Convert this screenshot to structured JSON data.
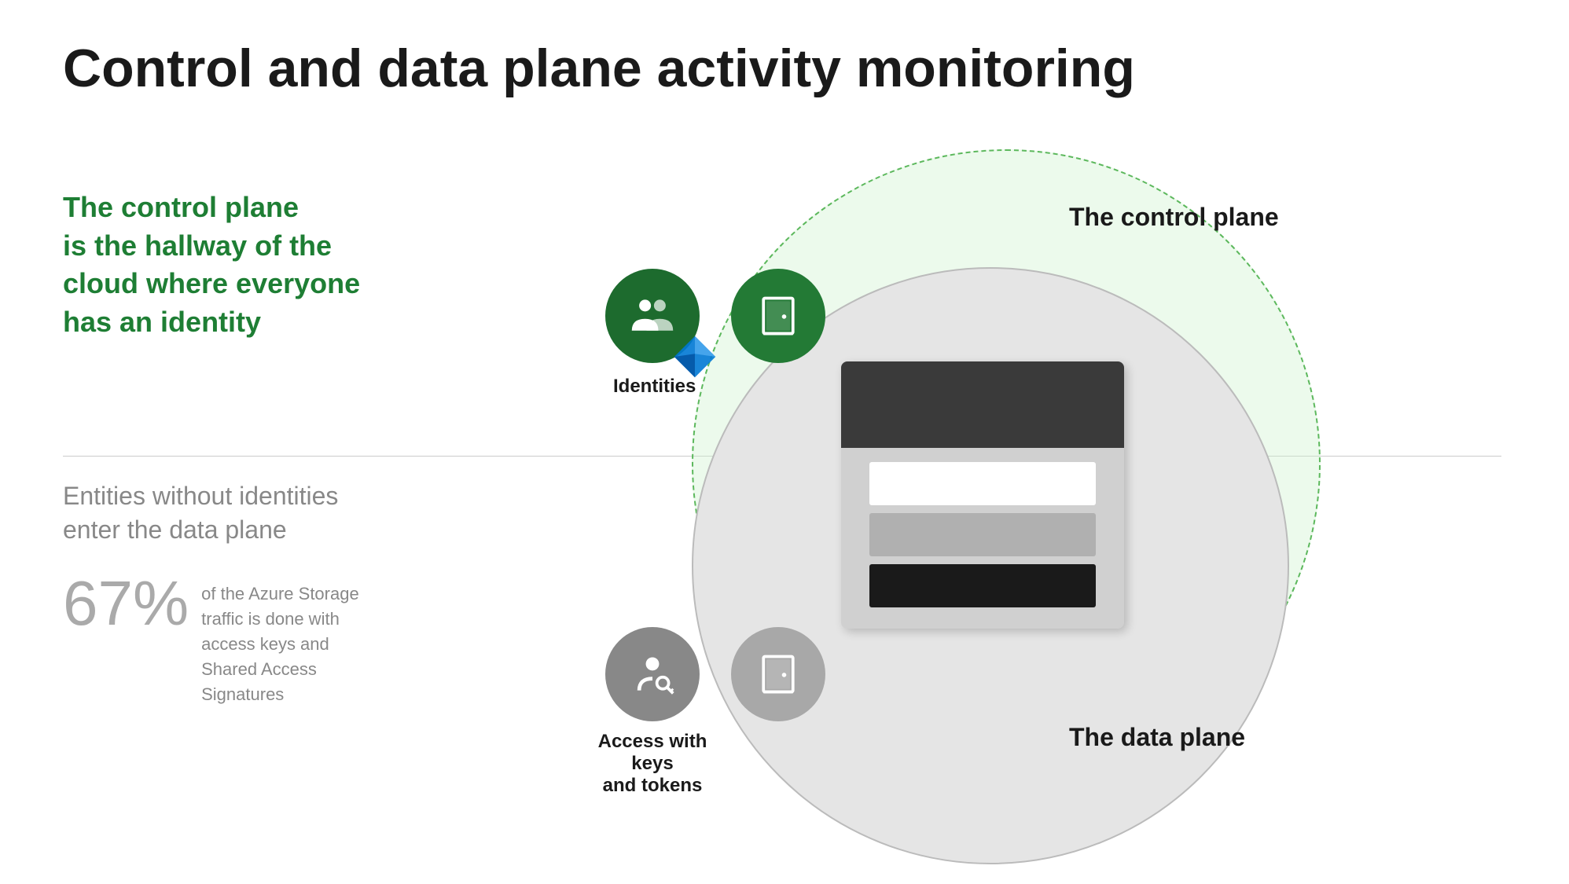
{
  "title": "Control and data plane activity monitoring",
  "left": {
    "green_line1": "The control plane",
    "green_line2": "is the hallway of the",
    "green_line3": "cloud where everyone",
    "green_line4": "has an identity"
  },
  "lower_left": {
    "gray_line1": "Entities without identities",
    "gray_line2": "enter the data plane",
    "stat_number": "67%",
    "stat_description": "of the Azure Storage traffic is done with access keys and Shared Access Signatures"
  },
  "diagram": {
    "control_plane_label": "The control plane",
    "data_plane_label": "The data plane",
    "identities_label": "Identities",
    "keys_label_line1": "Access with keys",
    "keys_label_line2": "and tokens"
  }
}
